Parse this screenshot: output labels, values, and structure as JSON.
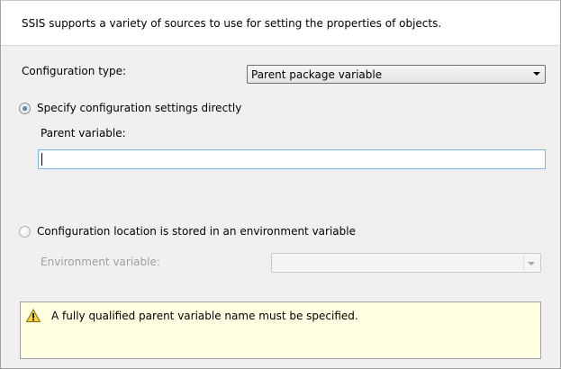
{
  "header": {
    "description": "SSIS supports a variety of sources to use for setting the properties of objects."
  },
  "configuration_type": {
    "label": "Configuration type:",
    "selected": "Parent package variable"
  },
  "direct_option": {
    "label": "Specify configuration settings directly",
    "checked": true
  },
  "parent_variable": {
    "label": "Parent variable:",
    "value": ""
  },
  "env_option": {
    "label": "Configuration location is stored in an environment variable",
    "checked": false
  },
  "environment_variable": {
    "label": "Environment variable:",
    "value": ""
  },
  "message": {
    "icon": "warning-icon",
    "text": "A fully qualified parent variable name must be specified."
  },
  "colors": {
    "message_background": "#ffffe1",
    "focus_border": "#7eb4ea"
  }
}
